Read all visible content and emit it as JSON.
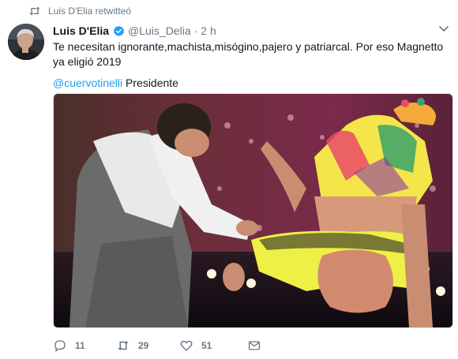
{
  "retweet": {
    "icon": "retweet-icon",
    "text": "Luis D'Elia retwitteó"
  },
  "tweet": {
    "author_name": "Luis D'Elia",
    "verified_icon": "verified-badge-icon",
    "handle": "@Luis_Delia",
    "separator": "·",
    "time": "2 h",
    "text": "Te necesitan ignorante,machista,misógino,pajero y patriarcal. Por eso Magnetto ya eligió 2019",
    "mention": "@cuervotinelli",
    "mention_suffix": " Presidente"
  },
  "actions": {
    "reply": {
      "icon": "reply-icon",
      "count": "11"
    },
    "retweet": {
      "icon": "retweet-icon",
      "count": "29"
    },
    "like": {
      "icon": "heart-icon",
      "count": "51"
    },
    "message": {
      "icon": "envelope-icon"
    }
  },
  "colors": {
    "link": "#1da1f2",
    "secondary_text": "#657786",
    "primary_text": "#14171a",
    "verified": "#1da1f2"
  }
}
